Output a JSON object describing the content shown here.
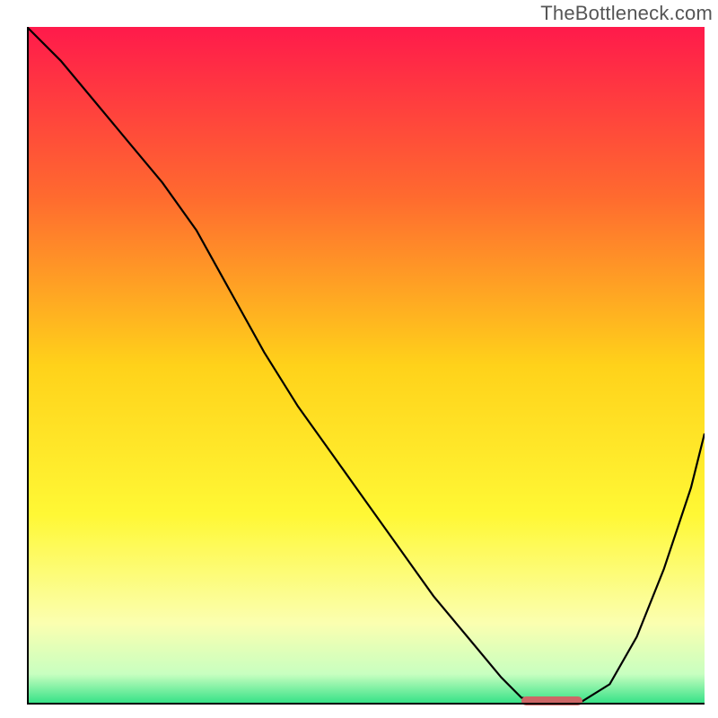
{
  "watermark": "TheBottleneck.com",
  "chart_data": {
    "type": "line",
    "title": "",
    "xlabel": "",
    "ylabel": "",
    "xlim": [
      0,
      100
    ],
    "ylim": [
      0,
      100
    ],
    "grid": false,
    "legend": false,
    "background_gradient": {
      "stops": [
        {
          "offset": 0.0,
          "color": "#ff1a4b"
        },
        {
          "offset": 0.25,
          "color": "#ff6a2f"
        },
        {
          "offset": 0.5,
          "color": "#ffd21a"
        },
        {
          "offset": 0.72,
          "color": "#fff835"
        },
        {
          "offset": 0.88,
          "color": "#fbffb0"
        },
        {
          "offset": 0.955,
          "color": "#c8ffc0"
        },
        {
          "offset": 1.0,
          "color": "#2fe084"
        }
      ]
    },
    "series": [
      {
        "name": "bottleneck-curve",
        "x": [
          0,
          5,
          10,
          15,
          20,
          25,
          30,
          35,
          40,
          45,
          50,
          55,
          60,
          65,
          70,
          73,
          78,
          82,
          86,
          90,
          94,
          98,
          100
        ],
        "y": [
          100,
          95,
          89,
          83,
          77,
          70,
          61,
          52,
          44,
          37,
          30,
          23,
          16,
          10,
          4,
          1,
          0.5,
          0.5,
          3,
          10,
          20,
          32,
          40
        ]
      }
    ],
    "annotations": [
      {
        "name": "optimal-range-marker",
        "kind": "hbar",
        "x_start": 73,
        "x_end": 82,
        "y": 0.5,
        "color": "#cc6666"
      }
    ]
  }
}
